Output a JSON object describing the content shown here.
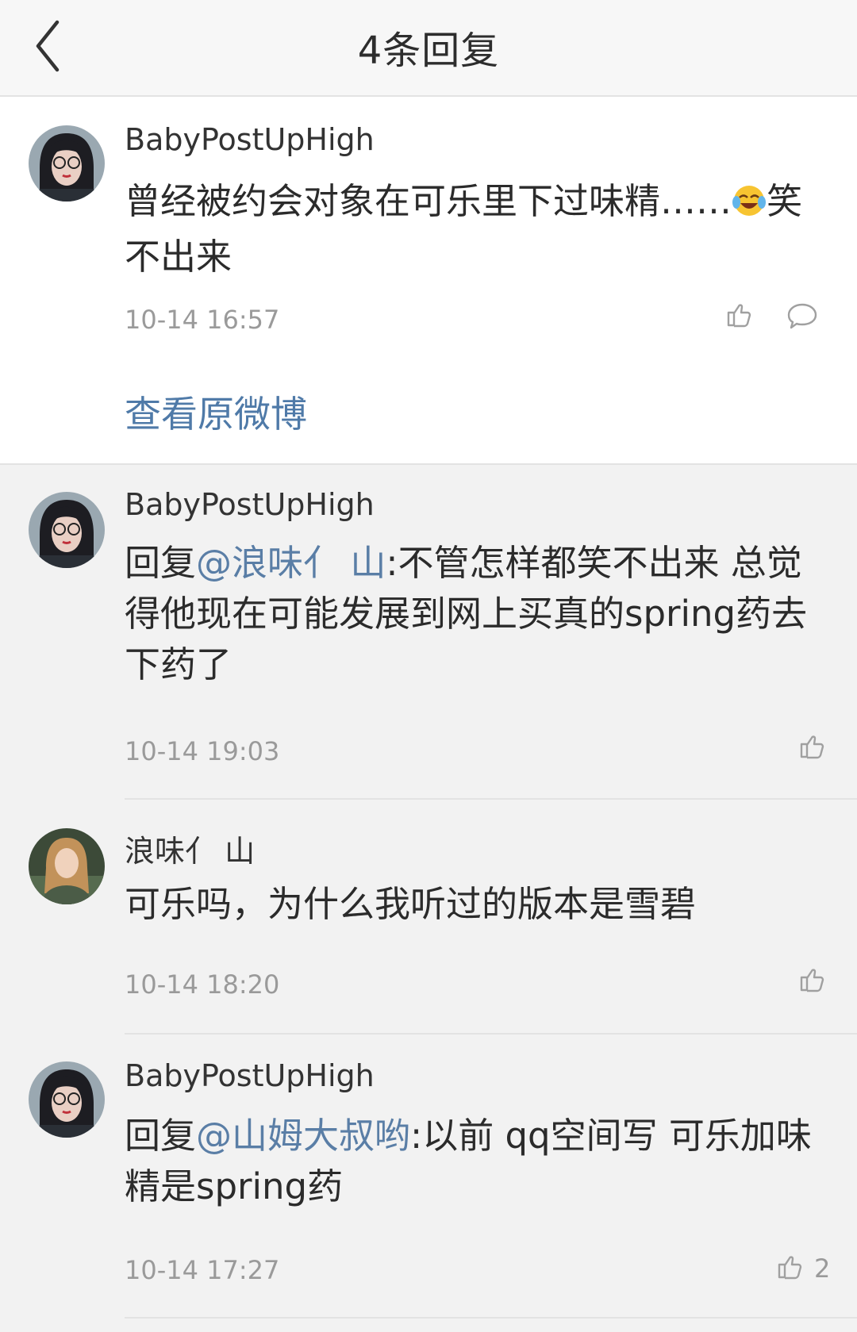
{
  "header": {
    "title": "4条回复",
    "back_icon": "chevron-left-icon"
  },
  "main_comment": {
    "username": "BabyPostUpHigh",
    "text_before_emoji": "曾经被约会对象在可乐里下过味精……",
    "emoji": "laughing-crying-emoji",
    "text_after_emoji": "笑不出来",
    "timestamp": "10-14 16:57",
    "view_original_label": "查看原微博"
  },
  "replies": [
    {
      "username": "BabyPostUpHigh",
      "prefix": "回复",
      "mention": "@浪味亻 山",
      "body": ":不管怎样都笑不出来 总觉得他现在可能发展到网上买真的spring药去下药了",
      "timestamp": "10-14 19:03",
      "likes": ""
    },
    {
      "username": "浪味亻 山",
      "prefix": "",
      "mention": "",
      "body": "可乐吗，为什么我听过的版本是雪碧",
      "timestamp": "10-14 18:20",
      "likes": ""
    },
    {
      "username": "BabyPostUpHigh",
      "prefix": "回复",
      "mention": "@山姆大叔哟",
      "body": ":以前 qq空间写 可乐加味精是spring药",
      "timestamp": "10-14 17:27",
      "likes": "2"
    }
  ],
  "colors": {
    "mention": "#5a7ea6",
    "link": "#4f7aa8",
    "muted": "#9a9a9a",
    "background": "#f2f2f2"
  }
}
